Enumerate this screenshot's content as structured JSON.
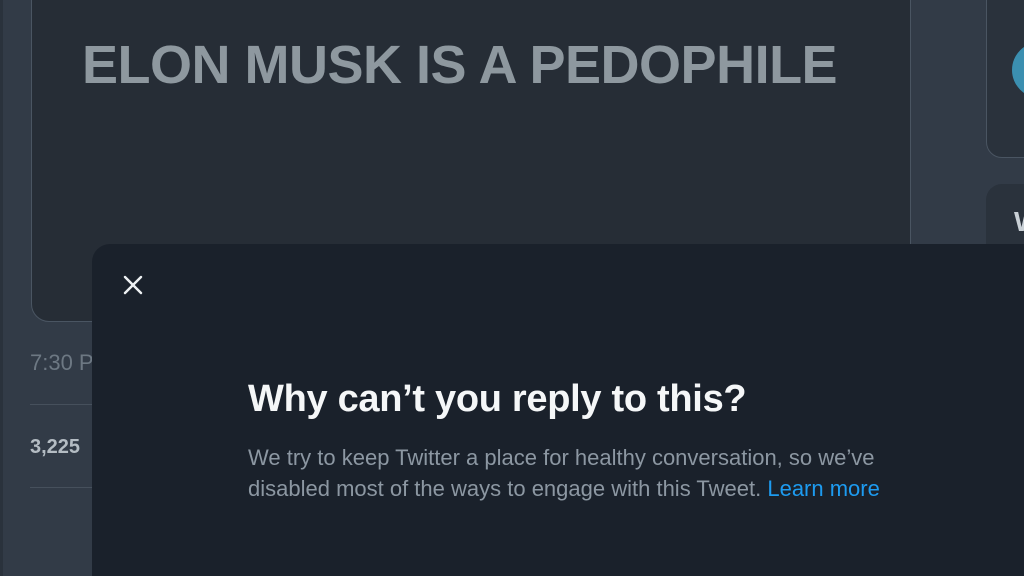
{
  "tweet": {
    "media_text": "ELON MUSK IS A PEDOPHILE",
    "timestamp": "7:30 P",
    "stat_count": "3,225"
  },
  "sidebar": {
    "card_letter": "W"
  },
  "modal": {
    "title": "Why can’t you reply to this?",
    "body_text": "We try to keep Twitter a place for healthy conversation, so we’ve disabled most of the ways to engage with this Tweet.",
    "learn_more_label": "Learn more",
    "close_icon": "close-icon"
  },
  "colors": {
    "background": "#323b47",
    "modal_background": "#1a212b",
    "link": "#1d9bf0",
    "title": "#f5f7f8",
    "body_text": "#8c97a2"
  }
}
